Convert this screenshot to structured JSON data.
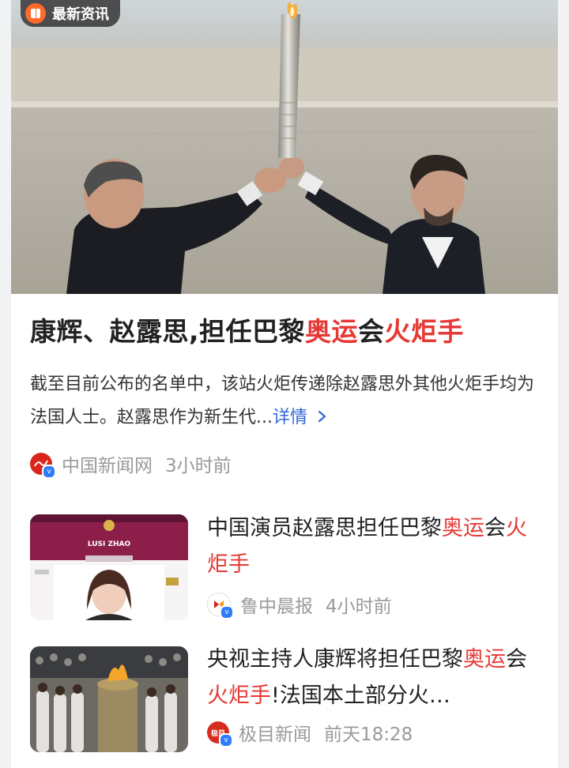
{
  "badge": {
    "label": "最新资讯",
    "icon": "news-app-icon"
  },
  "main_article": {
    "title_plain_1": "康辉、赵露思,担任巴黎",
    "title_hl_1": "奥运",
    "title_plain_2": "会",
    "title_hl_2": "火炬手",
    "summary": "截至目前公布的名单中，该站火炬传递除赵露思外其他火炬手均为法国人士。赵露思作为新生代...",
    "more_label": "详情",
    "more_icon": "chevron-right-icon",
    "source": "中国新闻网",
    "time": "3小时前"
  },
  "items": [
    {
      "title_plain_1": "中国演员赵露思担任巴黎",
      "title_hl_1": "奥运",
      "title_plain_2": "会",
      "title_hl_2": "火炬手",
      "title_plain_3": "",
      "source": "鲁中晨报",
      "time": "4小时前",
      "thumb_text": "LUSI ZHAO"
    },
    {
      "title_plain_1": "央视主持人康辉将担任巴黎",
      "title_hl_1": "奥运",
      "title_plain_2": "会",
      "title_hl_2": "火炬手",
      "title_plain_3": "!法国本土部分火…",
      "source": "极目新闻",
      "time": "前天18:28",
      "source_logo_text": "极目"
    }
  ],
  "colors": {
    "highlight": "#e53935",
    "link": "#3066d8",
    "verify": "#2f7df6",
    "badge_icon": "#ff6a2b"
  }
}
